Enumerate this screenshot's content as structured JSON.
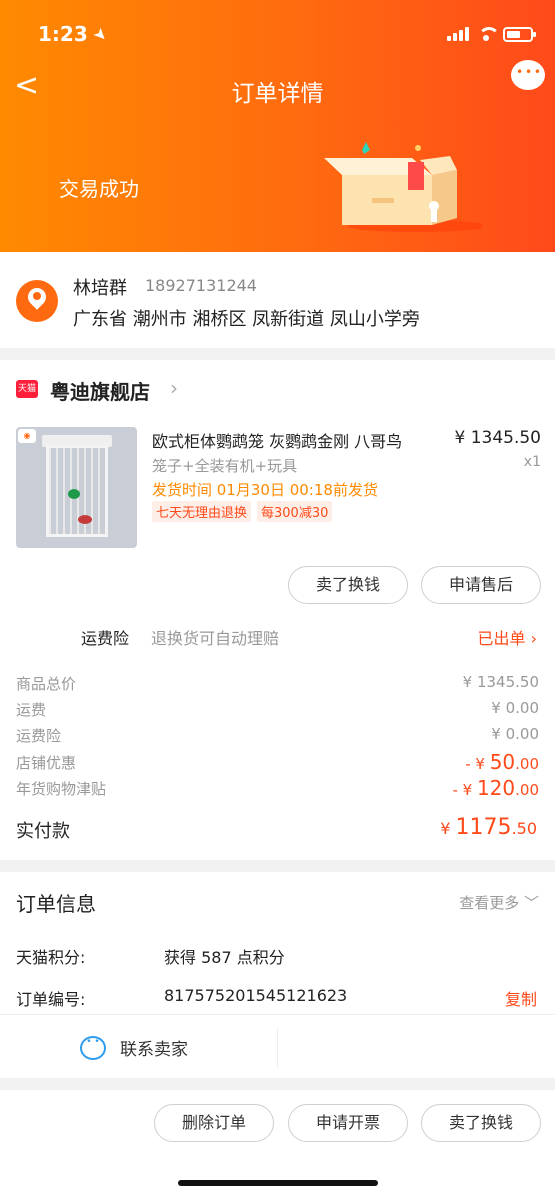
{
  "status_bar": {
    "time": "1:23"
  },
  "nav": {
    "back": "<",
    "title": "订单详情"
  },
  "hero": {
    "status": "交易成功"
  },
  "address": {
    "name": "林培群",
    "phone": "18927131244",
    "line": "广东省 潮州市 湘桥区 凤新街道 凤山小学旁"
  },
  "store": {
    "badge": "天猫",
    "name": "粤迪旗舰店",
    "arrow": "›"
  },
  "product": {
    "title": "欧式柜体鹦鹉笼 灰鹦鹉金刚 八哥鸟",
    "sku": "笼子+全装有机+玩具",
    "shipping": "发货时间 01月30日 00:18前发货",
    "tags": [
      "七天无理由退换",
      "每300减30"
    ],
    "price": "¥ 1345.50",
    "qty": "x1"
  },
  "item_buttons": {
    "sell": "卖了换钱",
    "after_sale": "申请售后"
  },
  "insurance": {
    "label": "运费险",
    "desc": "退换货可自动理赔",
    "status": "已出单 ›"
  },
  "fees": [
    {
      "label": "商品总价",
      "value": "¥ 1345.50"
    },
    {
      "label": "运费",
      "value": "¥ 0.00"
    },
    {
      "label": "运费险",
      "value": "¥ 0.00"
    },
    {
      "label": "店铺优惠",
      "prefix": "- ¥ ",
      "big": "50",
      "small": ".00"
    },
    {
      "label": "年货购物津贴",
      "prefix": "- ¥ ",
      "big": "120",
      "small": ".00"
    }
  ],
  "total": {
    "label": "实付款",
    "prefix": "¥ ",
    "big": "1175",
    "small": ".50"
  },
  "order_info": {
    "heading": "订单信息",
    "more": "查看更多 ﹀",
    "points_label": "天猫积分:",
    "points_value": "获得 587 点积分",
    "number_label": "订单编号:",
    "number_value": "817575201545121623",
    "copy": "复制",
    "contact": "联系卖家"
  },
  "footer_buttons": {
    "delete": "删除订单",
    "invoice": "申请开票",
    "sell": "卖了换钱"
  },
  "colors": {
    "accent": "#ff6a10",
    "price_red": "#ff4a1a",
    "tmall_red": "#ff1f3a",
    "ship_orange": "#ff8a00"
  }
}
